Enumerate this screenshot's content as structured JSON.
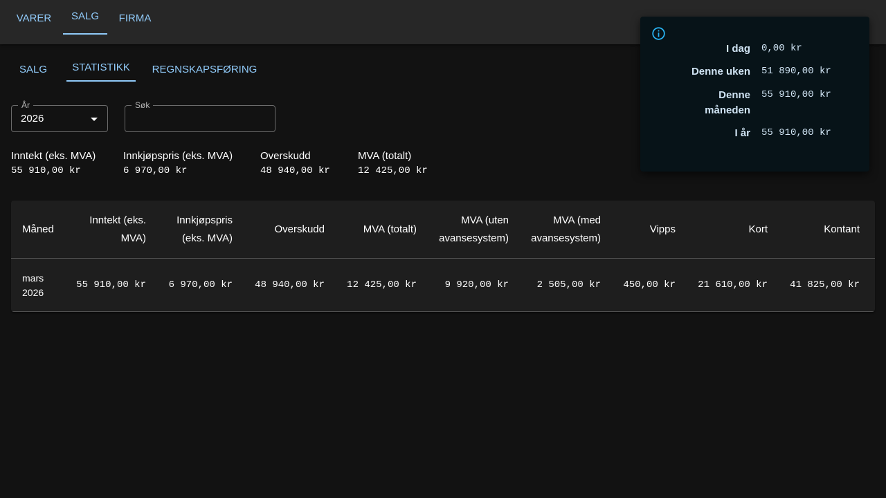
{
  "nav": {
    "tabs": [
      {
        "label": "VARER"
      },
      {
        "label": "SALG"
      },
      {
        "label": "FIRMA"
      }
    ]
  },
  "subnav": {
    "tabs": [
      {
        "label": "SALG"
      },
      {
        "label": "STATISTIKK"
      },
      {
        "label": "REGNSKAPSFØRING"
      }
    ]
  },
  "filters": {
    "year": {
      "label": "År",
      "value": "2026"
    },
    "search": {
      "label": "Søk",
      "value": ""
    }
  },
  "summary_stats": [
    {
      "label": "Inntekt (eks. MVA)",
      "value": "55 910,00 kr"
    },
    {
      "label": "Innkjøpspris (eks. MVA)",
      "value": "6 970,00 kr"
    },
    {
      "label": "Overskudd",
      "value": "48 940,00 kr"
    },
    {
      "label": "MVA (totalt)",
      "value": "12 425,00 kr"
    }
  ],
  "table": {
    "headers": [
      "Måned",
      "Inntekt (eks. MVA)",
      "Innkjøpspris (eks. MVA)",
      "Overskudd",
      "MVA (totalt)",
      "MVA (uten avansesystem)",
      "MVA (med avansesystem)",
      "Vipps",
      "Kort",
      "Kontant"
    ],
    "rows": [
      [
        "mars 2026",
        "55 910,00 kr",
        "6 970,00 kr",
        "48 940,00 kr",
        "12 425,00 kr",
        "9 920,00 kr",
        "2 505,00 kr",
        "450,00 kr",
        "21 610,00 kr",
        "41 825,00 kr"
      ]
    ]
  },
  "popup": {
    "icon": "info-icon",
    "rows": [
      {
        "label": "I dag",
        "value": "0,00 kr"
      },
      {
        "label": "Denne uken",
        "value": "51 890,00 kr"
      },
      {
        "label": "Denne måneden",
        "value": "55 910,00 kr"
      },
      {
        "label": "I år",
        "value": "55 910,00 kr"
      }
    ]
  },
  "colors": {
    "accent": "#90caf9",
    "background": "#121212",
    "appbar": "#272727",
    "card": "#1e1e1e",
    "popup": "#071318",
    "info_icon": "#29b6f6"
  }
}
